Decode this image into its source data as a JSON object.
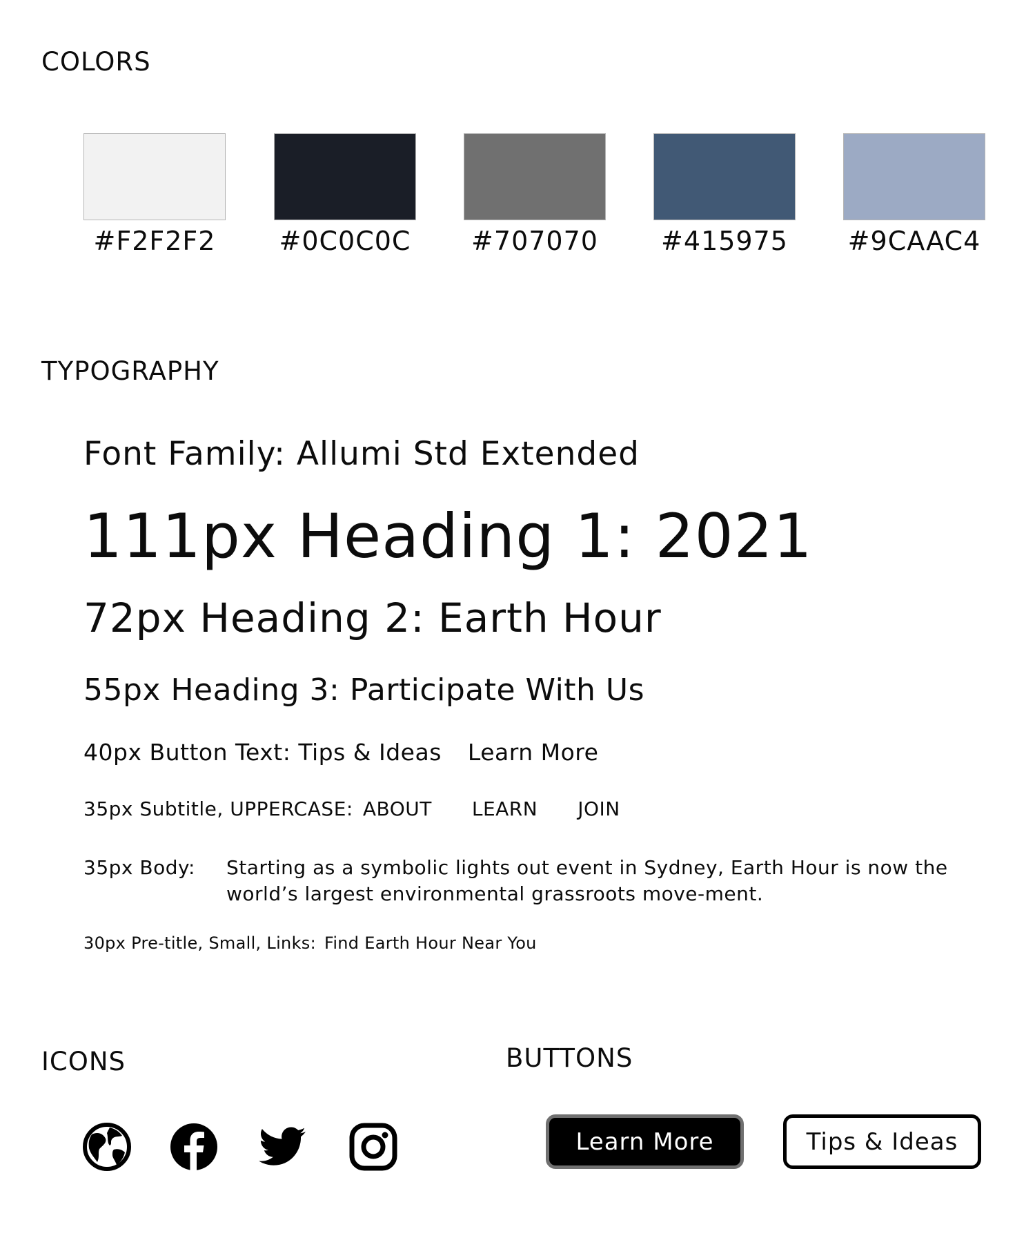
{
  "sections": {
    "colors": "COLORS",
    "typography": "TYPOGRAPHY",
    "icons": "ICONS",
    "buttons": "BUTTONS"
  },
  "colors": [
    {
      "hex": "#F2F2F2",
      "label": "#F2F2F2"
    },
    {
      "hex": "#1A1E27",
      "label": "#0C0C0C"
    },
    {
      "hex": "#707070",
      "label": "#707070"
    },
    {
      "hex": "#415975",
      "label": "#415975"
    },
    {
      "hex": "#9CAAC4",
      "label": "#9CAAC4"
    }
  ],
  "typography": {
    "font_family": "Font Family: Allumi Std Extended",
    "h1": "111px Heading 1: 2021",
    "h2": "72px Heading 2: Earth Hour",
    "h3": "55px Heading 3: Participate With Us",
    "button_text_label": "40px Button Text: Tips & Ideas",
    "button_text_example": "Learn More",
    "subtitle_label": "35px Subtitle, UPPERCASE:",
    "subtitle_examples": [
      "ABOUT",
      "LEARN",
      "JOIN"
    ],
    "body_label": "35px Body:",
    "body_text": "Starting as a symbolic lights out event in Sydney, Earth Hour is now the world’s largest environmental grassroots move-ment.",
    "pretitle_label": "30px Pre-title, Small, Links:",
    "pretitle_example": "Find Earth Hour Near You"
  },
  "icons": [
    "globe-icon",
    "facebook-icon",
    "twitter-icon",
    "instagram-icon"
  ],
  "buttons": {
    "primary_label": "Learn More",
    "secondary_label": "Tips & Ideas"
  }
}
